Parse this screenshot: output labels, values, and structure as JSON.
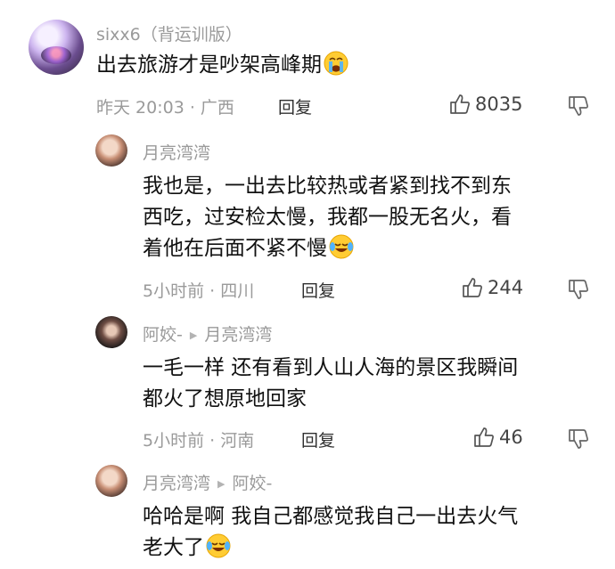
{
  "comments": [
    {
      "name": "sixx6（背运训版）",
      "text": "出去旅游才是吵架高峰期",
      "emoji": "crying-face",
      "meta": "昨天 20:03 · 广西",
      "reply_label": "回复",
      "likes": "8035"
    },
    {
      "name": "月亮湾湾",
      "text_lines": [
        "我也是，一出去比较热或者紧到找不到东",
        "西吃，过安检太慢，我都一股无名火，看",
        "着他在后面不紧不慢"
      ],
      "emoji": "tears-of-joy-face",
      "meta": "5小时前 · 四川",
      "reply_label": "回复",
      "likes": "244"
    },
    {
      "name": "阿姣-",
      "reply_to": "月亮湾湾",
      "text_lines": [
        "一毛一样 还有看到人山人海的景区我瞬间",
        "都火了想原地回家"
      ],
      "meta": "5小时前 · 河南",
      "reply_label": "回复",
      "likes": "46"
    },
    {
      "name": "月亮湾湾",
      "reply_to": "阿姣-",
      "text_lines": [
        "哈哈是啊 我自己都感觉我自己一出去火气",
        "老大了"
      ],
      "emoji": "tears-of-joy-face"
    }
  ]
}
